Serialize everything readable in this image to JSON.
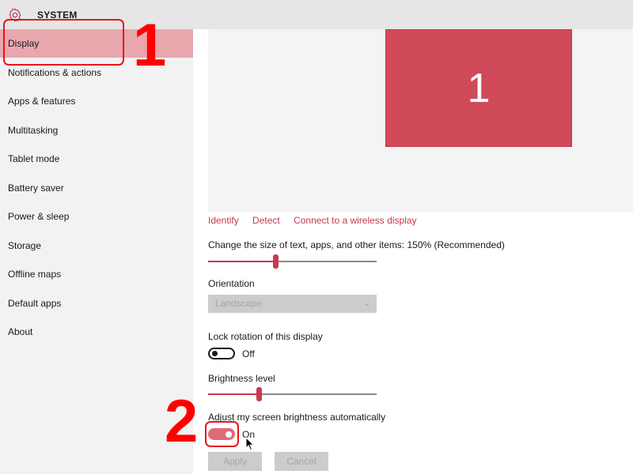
{
  "titlebar": {
    "icon": "gear-icon",
    "title": "SYSTEM"
  },
  "sidebar": {
    "active_index": 0,
    "items": [
      {
        "label": "Display"
      },
      {
        "label": "Notifications & actions"
      },
      {
        "label": "Apps & features"
      },
      {
        "label": "Multitasking"
      },
      {
        "label": "Tablet mode"
      },
      {
        "label": "Battery saver"
      },
      {
        "label": "Power & sleep"
      },
      {
        "label": "Storage"
      },
      {
        "label": "Offline maps"
      },
      {
        "label": "Default apps"
      },
      {
        "label": "About"
      }
    ]
  },
  "display": {
    "monitor_number": "1",
    "links": {
      "identify": "Identify",
      "detect": "Detect",
      "wireless": "Connect to a wireless display"
    },
    "scale": {
      "label": "Change the size of text, apps, and other items: 150% (Recommended)",
      "value_fraction": 0.4
    },
    "orientation": {
      "label": "Orientation",
      "selected": "Landscape",
      "disabled": true
    },
    "lock_rotation": {
      "label": "Lock rotation of this display",
      "state": "Off"
    },
    "brightness": {
      "label": "Brightness level",
      "value_fraction": 0.3
    },
    "auto_brightness": {
      "label": "Adjust my screen brightness automatically",
      "state": "On"
    },
    "buttons": {
      "apply": "Apply",
      "cancel": "Cancel"
    }
  },
  "annotations": {
    "step1": "1",
    "step2": "2"
  },
  "colors": {
    "accent": "#c2394e",
    "selected_nav": "#e8a7ad",
    "monitor": "#d04a59",
    "annotation": "#ff0000"
  }
}
